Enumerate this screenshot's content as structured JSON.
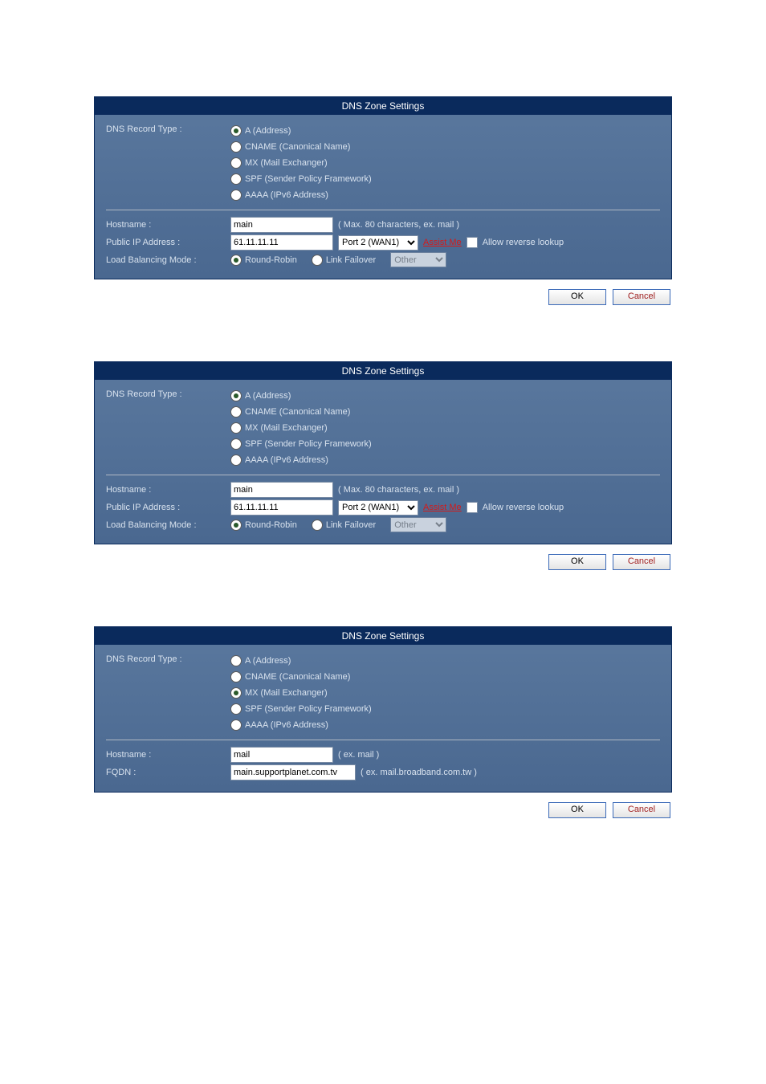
{
  "header_title": "DNS Zone Settings",
  "record_type_label": "DNS Record Type :",
  "record_types": {
    "a": "A (Address)",
    "cname": "CNAME (Canonical Name)",
    "mx": "MX (Mail Exchanger)",
    "spf": "SPF (Sender Policy Framework)",
    "aaaa": "AAAA (IPv6 Address)"
  },
  "hostname_label": "Hostname :",
  "public_ip_label": "Public IP Address :",
  "load_balancing_label": "Load Balancing Mode :",
  "fqdn_label": "FQDN :",
  "panel1": {
    "hostname_value": "main",
    "hostname_hint": "( Max. 80 characters, ex. mail )",
    "ip_value": "61.11.11.11",
    "port_selected": "Port 2 (WAN1)",
    "assist_label": "Assist Me",
    "reverse_lookup_label": "Allow reverse lookup",
    "lb_round_robin": "Round-Robin",
    "lb_link_failover": "Link Failover",
    "lb_other_option": "Other"
  },
  "panel2": {
    "hostname_value": "main",
    "hostname_hint": "( Max. 80 characters, ex. mail )",
    "ip_value": "61.11.11.11",
    "port_selected": "Port 2 (WAN1)",
    "assist_label": "Assist Me",
    "reverse_lookup_label": "Allow reverse lookup",
    "lb_round_robin": "Round-Robin",
    "lb_link_failover": "Link Failover",
    "lb_other_option": "Other"
  },
  "panel3": {
    "hostname_value": "mail",
    "hostname_hint": "( ex. mail )",
    "fqdn_value": "main.supportplanet.com.tv",
    "fqdn_hint": "( ex. mail.broadband.com.tw )"
  },
  "buttons": {
    "ok": "OK",
    "cancel": "Cancel"
  }
}
